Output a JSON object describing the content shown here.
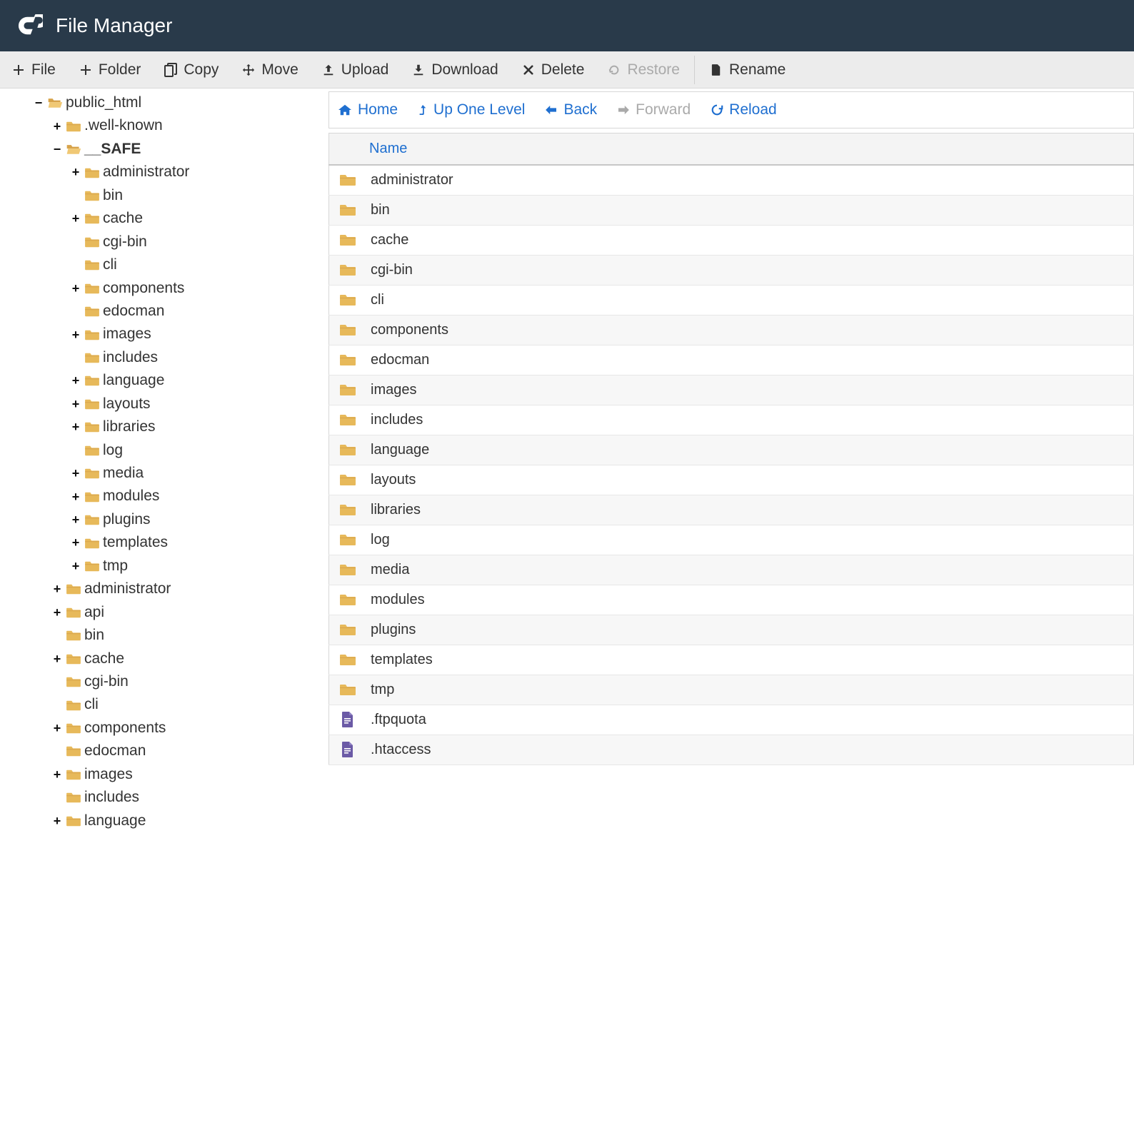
{
  "header": {
    "title": "File Manager"
  },
  "toolbar": {
    "file": "File",
    "folder": "Folder",
    "copy": "Copy",
    "move": "Move",
    "upload": "Upload",
    "download": "Download",
    "delete": "Delete",
    "restore": "Restore",
    "rename": "Rename"
  },
  "nav": {
    "home": "Home",
    "up": "Up One Level",
    "back": "Back",
    "forward": "Forward",
    "reload": "Reload"
  },
  "colheader": {
    "name": "Name"
  },
  "tree": {
    "root": {
      "label": "public_html"
    },
    "wellknown": ".well-known",
    "safe": "__SAFE",
    "safe_children": {
      "administrator": "administrator",
      "bin": "bin",
      "cache": "cache",
      "cgibin": "cgi-bin",
      "cli": "cli",
      "components": "components",
      "edocman": "edocman",
      "images": "images",
      "includes": "includes",
      "language": "language",
      "layouts": "layouts",
      "libraries": "libraries",
      "log": "log",
      "media": "media",
      "modules": "modules",
      "plugins": "plugins",
      "templates": "templates",
      "tmp": "tmp"
    },
    "public_children": {
      "administrator": "administrator",
      "api": "api",
      "bin": "bin",
      "cache": "cache",
      "cgibin": "cgi-bin",
      "cli": "cli",
      "components": "components",
      "edocman": "edocman",
      "images": "images",
      "includes": "includes",
      "language": "language"
    }
  },
  "files": [
    {
      "name": "administrator",
      "type": "folder"
    },
    {
      "name": "bin",
      "type": "folder"
    },
    {
      "name": "cache",
      "type": "folder"
    },
    {
      "name": "cgi-bin",
      "type": "folder"
    },
    {
      "name": "cli",
      "type": "folder"
    },
    {
      "name": "components",
      "type": "folder"
    },
    {
      "name": "edocman",
      "type": "folder"
    },
    {
      "name": "images",
      "type": "folder"
    },
    {
      "name": "includes",
      "type": "folder"
    },
    {
      "name": "language",
      "type": "folder"
    },
    {
      "name": "layouts",
      "type": "folder"
    },
    {
      "name": "libraries",
      "type": "folder"
    },
    {
      "name": "log",
      "type": "folder"
    },
    {
      "name": "media",
      "type": "folder"
    },
    {
      "name": "modules",
      "type": "folder"
    },
    {
      "name": "plugins",
      "type": "folder"
    },
    {
      "name": "templates",
      "type": "folder"
    },
    {
      "name": "tmp",
      "type": "folder"
    },
    {
      "name": ".ftpquota",
      "type": "file"
    },
    {
      "name": ".htaccess",
      "type": "file"
    }
  ]
}
